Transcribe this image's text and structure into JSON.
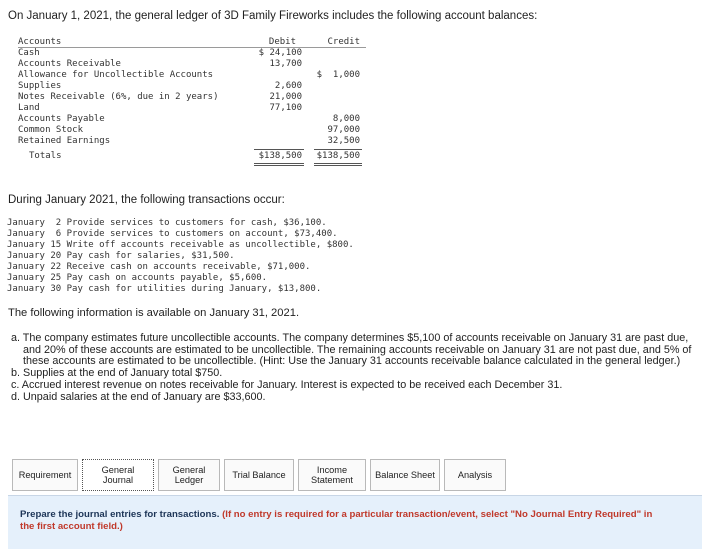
{
  "intro": "On January 1, 2021, the general ledger of 3D Family Fireworks includes the following account balances:",
  "ledger": {
    "headers": {
      "accounts": "Accounts",
      "debit": "Debit",
      "credit": "Credit"
    },
    "rows": [
      {
        "name": "Cash",
        "debit": "$ 24,100",
        "credit": ""
      },
      {
        "name": "Accounts Receivable",
        "debit": "13,700",
        "credit": ""
      },
      {
        "name": "Allowance for Uncollectible Accounts",
        "debit": "",
        "credit": "$  1,000"
      },
      {
        "name": "Supplies",
        "debit": "2,600",
        "credit": ""
      },
      {
        "name": "Notes Receivable (6%, due in 2 years)",
        "debit": "21,000",
        "credit": ""
      },
      {
        "name": "Land",
        "debit": "77,100",
        "credit": ""
      },
      {
        "name": "Accounts Payable",
        "debit": "",
        "credit": "8,000"
      },
      {
        "name": "Common Stock",
        "debit": "",
        "credit": "97,000"
      },
      {
        "name": "Retained Earnings",
        "debit": "",
        "credit": "32,500"
      }
    ],
    "totals": {
      "name": "Totals",
      "debit": "$138,500",
      "credit": "$138,500"
    }
  },
  "transactions_heading": "During January 2021, the following transactions occur:",
  "transactions": [
    "January  2 Provide services to customers for cash, $36,100.",
    "January  6 Provide services to customers on account, $73,400.",
    "January 15 Write off accounts receivable as uncollectible, $800.",
    "January 20 Pay cash for salaries, $31,500.",
    "January 22 Receive cash on accounts receivable, $71,000.",
    "January 25 Pay cash on accounts payable, $5,600.",
    "January 30 Pay cash for utilities during January, $13,800."
  ],
  "info_heading": "The following information is available on January 31, 2021.",
  "items": [
    "a. The company estimates future uncollectible accounts. The company determines $5,100 of accounts receivable on January 31 are past due, and 20% of these accounts are estimated to be uncollectible. The remaining accounts receivable on January 31 are not past due, and 5% of these accounts are estimated to be uncollectible. (Hint: Use the January 31 accounts receivable balance calculated in the general ledger.)",
    "b. Supplies at the end of January total $750.",
    "c. Accrued interest revenue on notes receivable for January. Interest is expected to be received each December 31.",
    "d. Unpaid salaries at the end of January are $33,600."
  ],
  "tabs": [
    {
      "label": "Requirement"
    },
    {
      "label": "General\nJournal",
      "active": true
    },
    {
      "label": "General\nLedger"
    },
    {
      "label": "Trial Balance"
    },
    {
      "label": "Income\nStatement"
    },
    {
      "label": "Balance Sheet"
    },
    {
      "label": "Analysis"
    }
  ],
  "instruction": {
    "main": "Prepare the journal entries for transactions.",
    "note": "(If no entry is required for a particular transaction/event, select \"No Journal Entry Required\" in the first account field.)"
  }
}
